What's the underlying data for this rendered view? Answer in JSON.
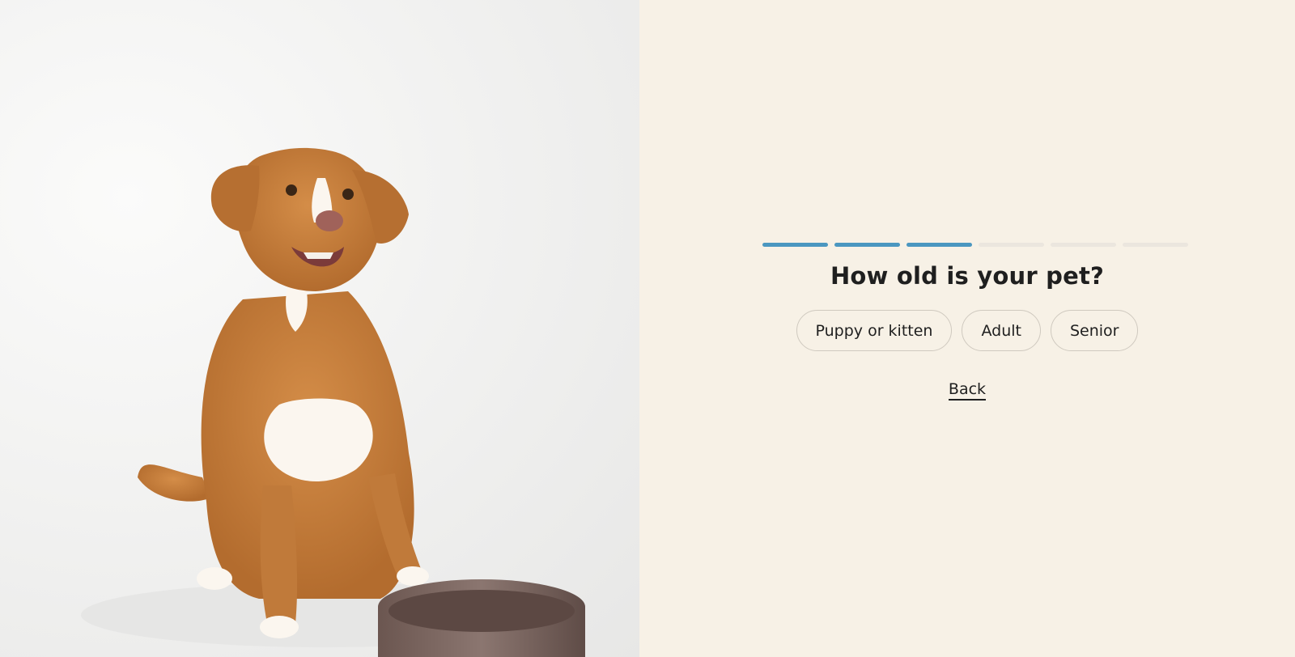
{
  "photo": {
    "alt": "Golden dog sitting next to a brown ceramic food bowl",
    "colors": {
      "background": "#eeeeed",
      "fur": "#c8813f",
      "fur_dark": "#a8632a",
      "chest": "#fbf6ef",
      "bowl": "#7a6660",
      "bowl_rim": "#8d7872"
    }
  },
  "quiz": {
    "progress": {
      "completed": 3,
      "total": 6
    },
    "question": "How old is your pet?",
    "options": [
      "Puppy or kitten",
      "Adult",
      "Senior"
    ],
    "back_label": "Back"
  },
  "colors": {
    "panel_background": "#f7f1e6",
    "accent": "#4b97c0",
    "progress_track": "#ebe6de",
    "text": "#1f1f1f",
    "option_border": "#cfc9bf"
  }
}
